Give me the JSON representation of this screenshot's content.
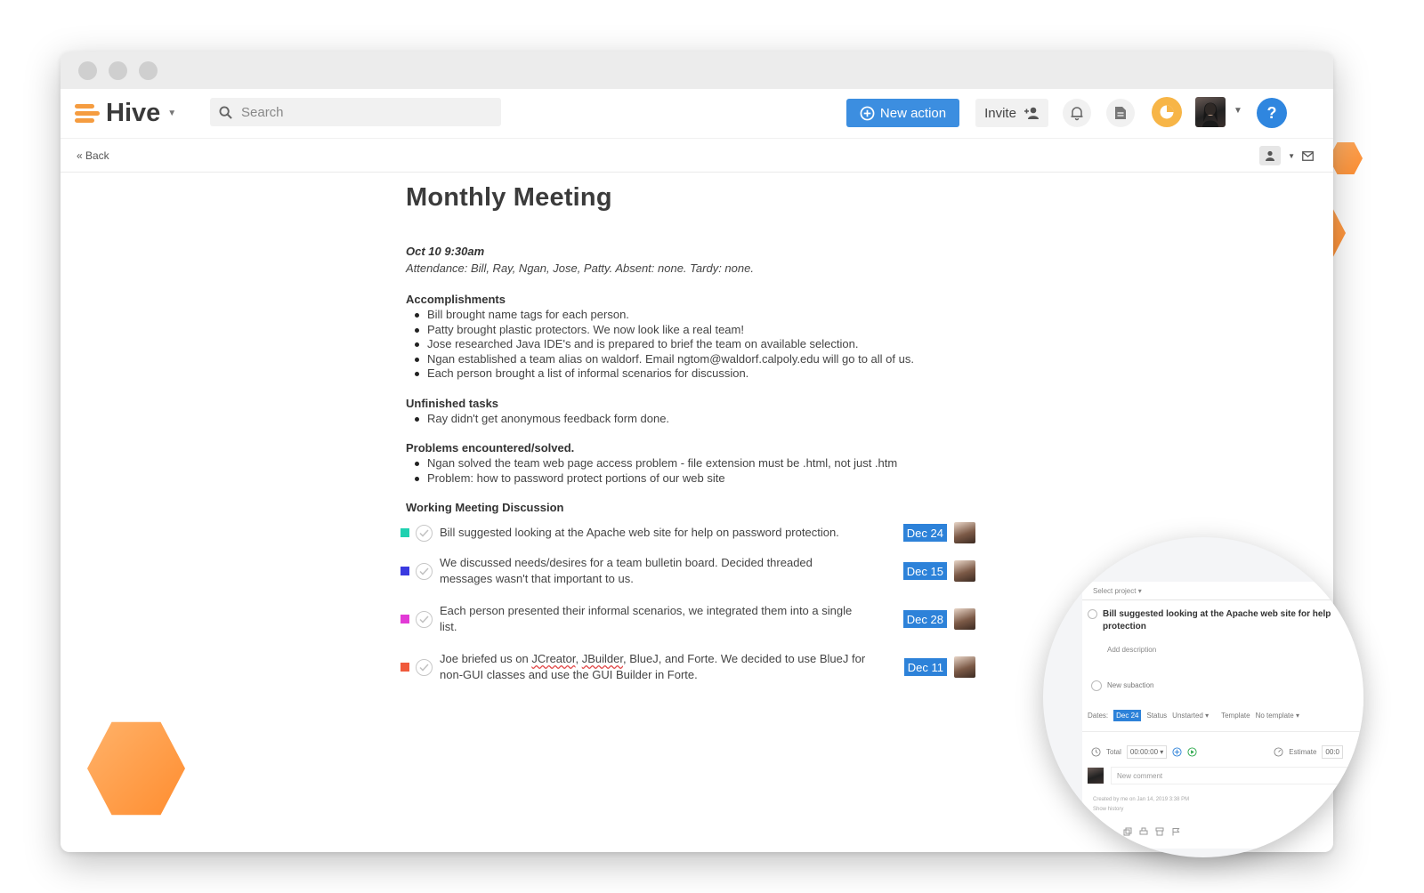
{
  "app": {
    "name": "Hive"
  },
  "search": {
    "placeholder": "Search"
  },
  "header": {
    "new_action_label": "New action",
    "invite_label": "Invite"
  },
  "subbar": {
    "back_label": "« Back"
  },
  "note": {
    "title": "Monthly Meeting",
    "date": "Oct 10 9:30am",
    "attendance": "Attendance: Bill, Ray, Ngan, Jose, Patty.  Absent: none.  Tardy: none.",
    "sections": [
      {
        "heading": "Accomplishments",
        "items": [
          "Bill brought name tags for each person.",
          "Patty brought plastic protectors.  We now look like a real team!",
          "Jose researched Java IDE's and is prepared to brief the team on available selection.",
          "Ngan established a team alias on waldorf.  Email ngtom@waldorf.calpoly.edu will go to all of us.",
          "Each person brought a list of informal scenarios for discussion."
        ]
      },
      {
        "heading": "Unfinished tasks",
        "items": [
          "Ray didn't get anonymous feedback form done."
        ]
      },
      {
        "heading": "Problems encountered/solved.",
        "items": [
          "Ngan solved the team web page access problem - file extension must be .html, not just .htm",
          "Problem: how to password protect portions of our web site"
        ]
      }
    ],
    "discussion_heading": "Working Meeting Discussion",
    "actions": [
      {
        "text": "Bill suggested looking at the Apache web site for help on password protection.",
        "due": "Dec 24",
        "color": "#1fd1b0"
      },
      {
        "text": "We discussed needs/desires for a team bulletin board.  Decided threaded messages wasn't that important to us.",
        "due": "Dec 15",
        "color": "#3a3ae0"
      },
      {
        "text": "Each person presented their informal scenarios, we integrated them into a single list.",
        "due": "Dec 28",
        "color": "#e23ad6"
      },
      {
        "text_before": "Joe briefed us on ",
        "text_w1": "JCreator",
        "text_sep": ", ",
        "text_w2": "JBuilder",
        "text_after": ", BlueJ, and Forte. We decided to use BlueJ for non-GUI classes and use the GUI Builder in Forte.",
        "due": "Dec 11",
        "color": "#f05a3c"
      }
    ]
  },
  "detail": {
    "select_project": "Select project",
    "task_title": "Bill suggested looking at the Apache web site for help protection",
    "add_description": "Add description",
    "new_subaction": "New subaction",
    "dates_label": "Dates:",
    "dates_value": "Dec 24",
    "status_label": "Status",
    "status_value": "Unstarted",
    "template_label": "Template",
    "template_value": "No template",
    "total_label": "Total",
    "total_value": "00:00:00",
    "estimate_label": "Estimate",
    "estimate_value": "00:0",
    "comment_placeholder": "New comment",
    "created_by": "Created by me on Jan 14, 2019 3:38 PM",
    "show_history": "Show history"
  }
}
